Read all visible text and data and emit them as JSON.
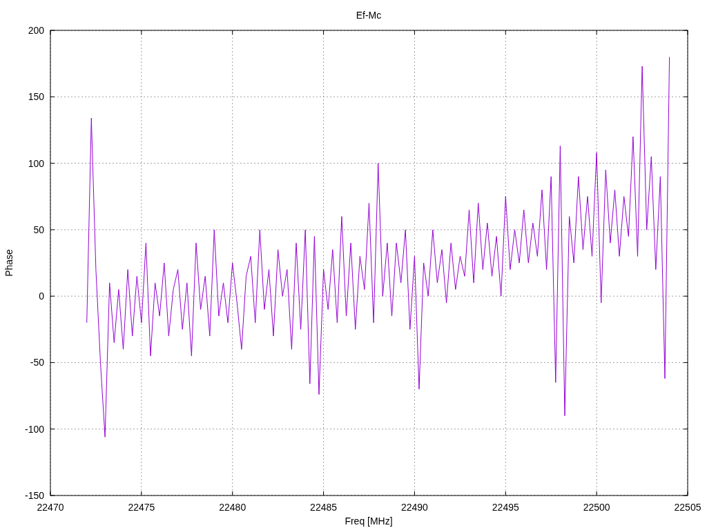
{
  "chart_data": {
    "type": "line",
    "title": "Ef-Mc",
    "xlabel": "Freq [MHz]",
    "ylabel": "Phase",
    "grid": true,
    "xlim": [
      22470,
      22505
    ],
    "ylim": [
      -150,
      200
    ],
    "xticks": [
      22470,
      22475,
      22480,
      22485,
      22490,
      22495,
      22500,
      22505
    ],
    "yticks": [
      -150,
      -100,
      -50,
      0,
      50,
      100,
      150,
      200
    ],
    "x": [
      22472,
      22472.25,
      22472.5,
      22472.75,
      22473,
      22473.25,
      22473.5,
      22473.75,
      22474,
      22474.25,
      22474.5,
      22474.75,
      22475,
      22475.25,
      22475.5,
      22475.75,
      22476,
      22476.25,
      22476.5,
      22476.75,
      22477,
      22477.25,
      22477.5,
      22477.75,
      22478,
      22478.25,
      22478.5,
      22478.75,
      22479,
      22479.25,
      22479.5,
      22479.75,
      22480,
      22480.25,
      22480.5,
      22480.75,
      22481,
      22481.25,
      22481.5,
      22481.75,
      22482,
      22482.25,
      22482.5,
      22482.75,
      22483,
      22483.25,
      22483.5,
      22483.75,
      22484,
      22484.25,
      22484.5,
      22484.75,
      22485,
      22485.25,
      22485.5,
      22485.75,
      22486,
      22486.25,
      22486.5,
      22486.75,
      22487,
      22487.25,
      22487.5,
      22487.75,
      22488,
      22488.25,
      22488.5,
      22488.75,
      22489,
      22489.25,
      22489.5,
      22489.75,
      22490,
      22490.25,
      22490.5,
      22490.75,
      22491,
      22491.25,
      22491.5,
      22491.75,
      22492,
      22492.25,
      22492.5,
      22492.75,
      22493,
      22493.25,
      22493.5,
      22493.75,
      22494,
      22494.25,
      22494.5,
      22494.75,
      22495,
      22495.25,
      22495.5,
      22495.75,
      22496,
      22496.25,
      22496.5,
      22496.75,
      22497,
      22497.25,
      22497.5,
      22497.75,
      22498,
      22498.25,
      22498.5,
      22498.75,
      22499,
      22499.25,
      22499.5,
      22499.75,
      22500,
      22500.25,
      22500.5,
      22500.75,
      22501,
      22501.25,
      22501.5,
      22501.75,
      22502,
      22502.25,
      22502.5,
      22502.75,
      22503,
      22503.25,
      22503.5,
      22503.75,
      22504
    ],
    "series": [
      {
        "color": "#9400d3",
        "values": [
          -20,
          134,
          20,
          -50,
          -106,
          10,
          -35,
          5,
          -40,
          20,
          -30,
          15,
          -20,
          40,
          -45,
          10,
          -15,
          25,
          -30,
          5,
          20,
          -25,
          10,
          -45,
          40,
          -10,
          15,
          -30,
          50,
          -15,
          10,
          -20,
          25,
          -5,
          -40,
          15,
          30,
          -20,
          50,
          -10,
          20,
          -30,
          35,
          0,
          20,
          -40,
          40,
          -25,
          50,
          -66,
          45,
          -74,
          20,
          -10,
          35,
          -20,
          60,
          -15,
          40,
          -25,
          30,
          5,
          70,
          -20,
          100,
          0,
          40,
          -15,
          40,
          10,
          50,
          -25,
          30,
          -70,
          25,
          0,
          50,
          10,
          35,
          -5,
          40,
          5,
          30,
          15,
          65,
          10,
          70,
          20,
          55,
          15,
          45,
          0,
          75,
          20,
          50,
          25,
          65,
          25,
          55,
          30,
          80,
          20,
          90,
          -65,
          113,
          -90,
          60,
          25,
          90,
          35,
          75,
          30,
          108,
          -5,
          95,
          40,
          80,
          30,
          75,
          45,
          120,
          30,
          173,
          50,
          105,
          20,
          90,
          -62,
          180
        ]
      }
    ]
  }
}
